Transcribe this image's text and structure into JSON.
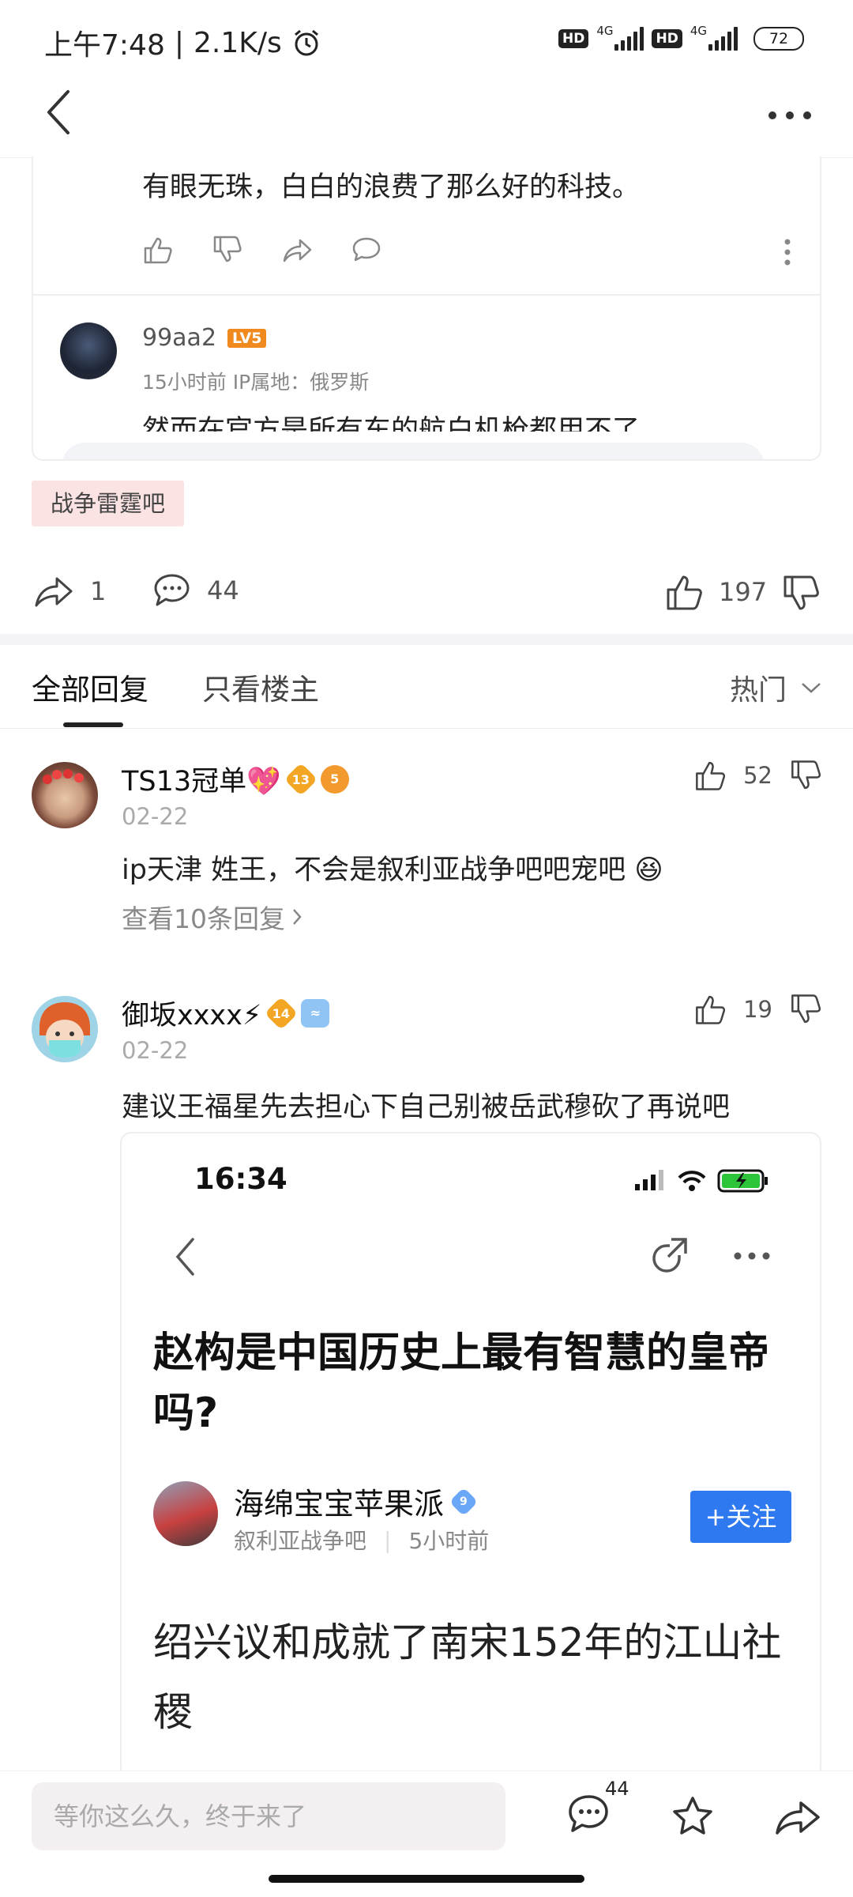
{
  "status_bar": {
    "time": "上午7:48",
    "speed": "2.1K/s",
    "hd": "HD",
    "net1": "4G",
    "net2": "4G",
    "battery": "72"
  },
  "quoted_post": {
    "text": "有眼无珠，白白的浪费了那么好的科技。",
    "reply": {
      "user": "99aa2",
      "level": "LV5",
      "meta": "15小时前  IP属地：俄罗斯",
      "cut_text": "然而在官方是所有东的航白机枪都用不了"
    }
  },
  "forum_tag": "战争雷霆吧",
  "actions": {
    "share_count": "1",
    "comment_count": "44",
    "like_count": "197"
  },
  "tabs": {
    "all": "全部回复",
    "owner": "只看楼主",
    "sort": "热门"
  },
  "comments": [
    {
      "user": "TS13冠单💖",
      "badge1": "13",
      "badge2": "5",
      "date": "02-22",
      "likes": "52",
      "text": "ip天津 姓王，不会是叙利亚战争吧吧宠吧 😆",
      "more": "查看10条回复"
    },
    {
      "user": "御坂xxxx⚡",
      "badge1": "14",
      "badge2": "≈",
      "date": "02-22",
      "likes": "19",
      "text": "建议王福星先去担心下自己别被岳武穆砍了再说吧"
    }
  ],
  "embedded_screenshot": {
    "time": "16:34",
    "title": "赵构是中国历史上最有智慧的皇帝吗?",
    "author": "海绵宝宝苹果派",
    "author_badge": "9",
    "forum": "叙利亚战争吧",
    "time_ago": "5小时前",
    "follow": "+关注",
    "body": "绍兴议和成就了南宋152年的江山社稷"
  },
  "bottom_bar": {
    "placeholder": "等你这么久，终于来了",
    "comment_count": "44"
  },
  "colors": {
    "tag_bg": "#fbe3e3",
    "follow_blue": "#2f79f0",
    "level_orange": "#f08a1e"
  }
}
